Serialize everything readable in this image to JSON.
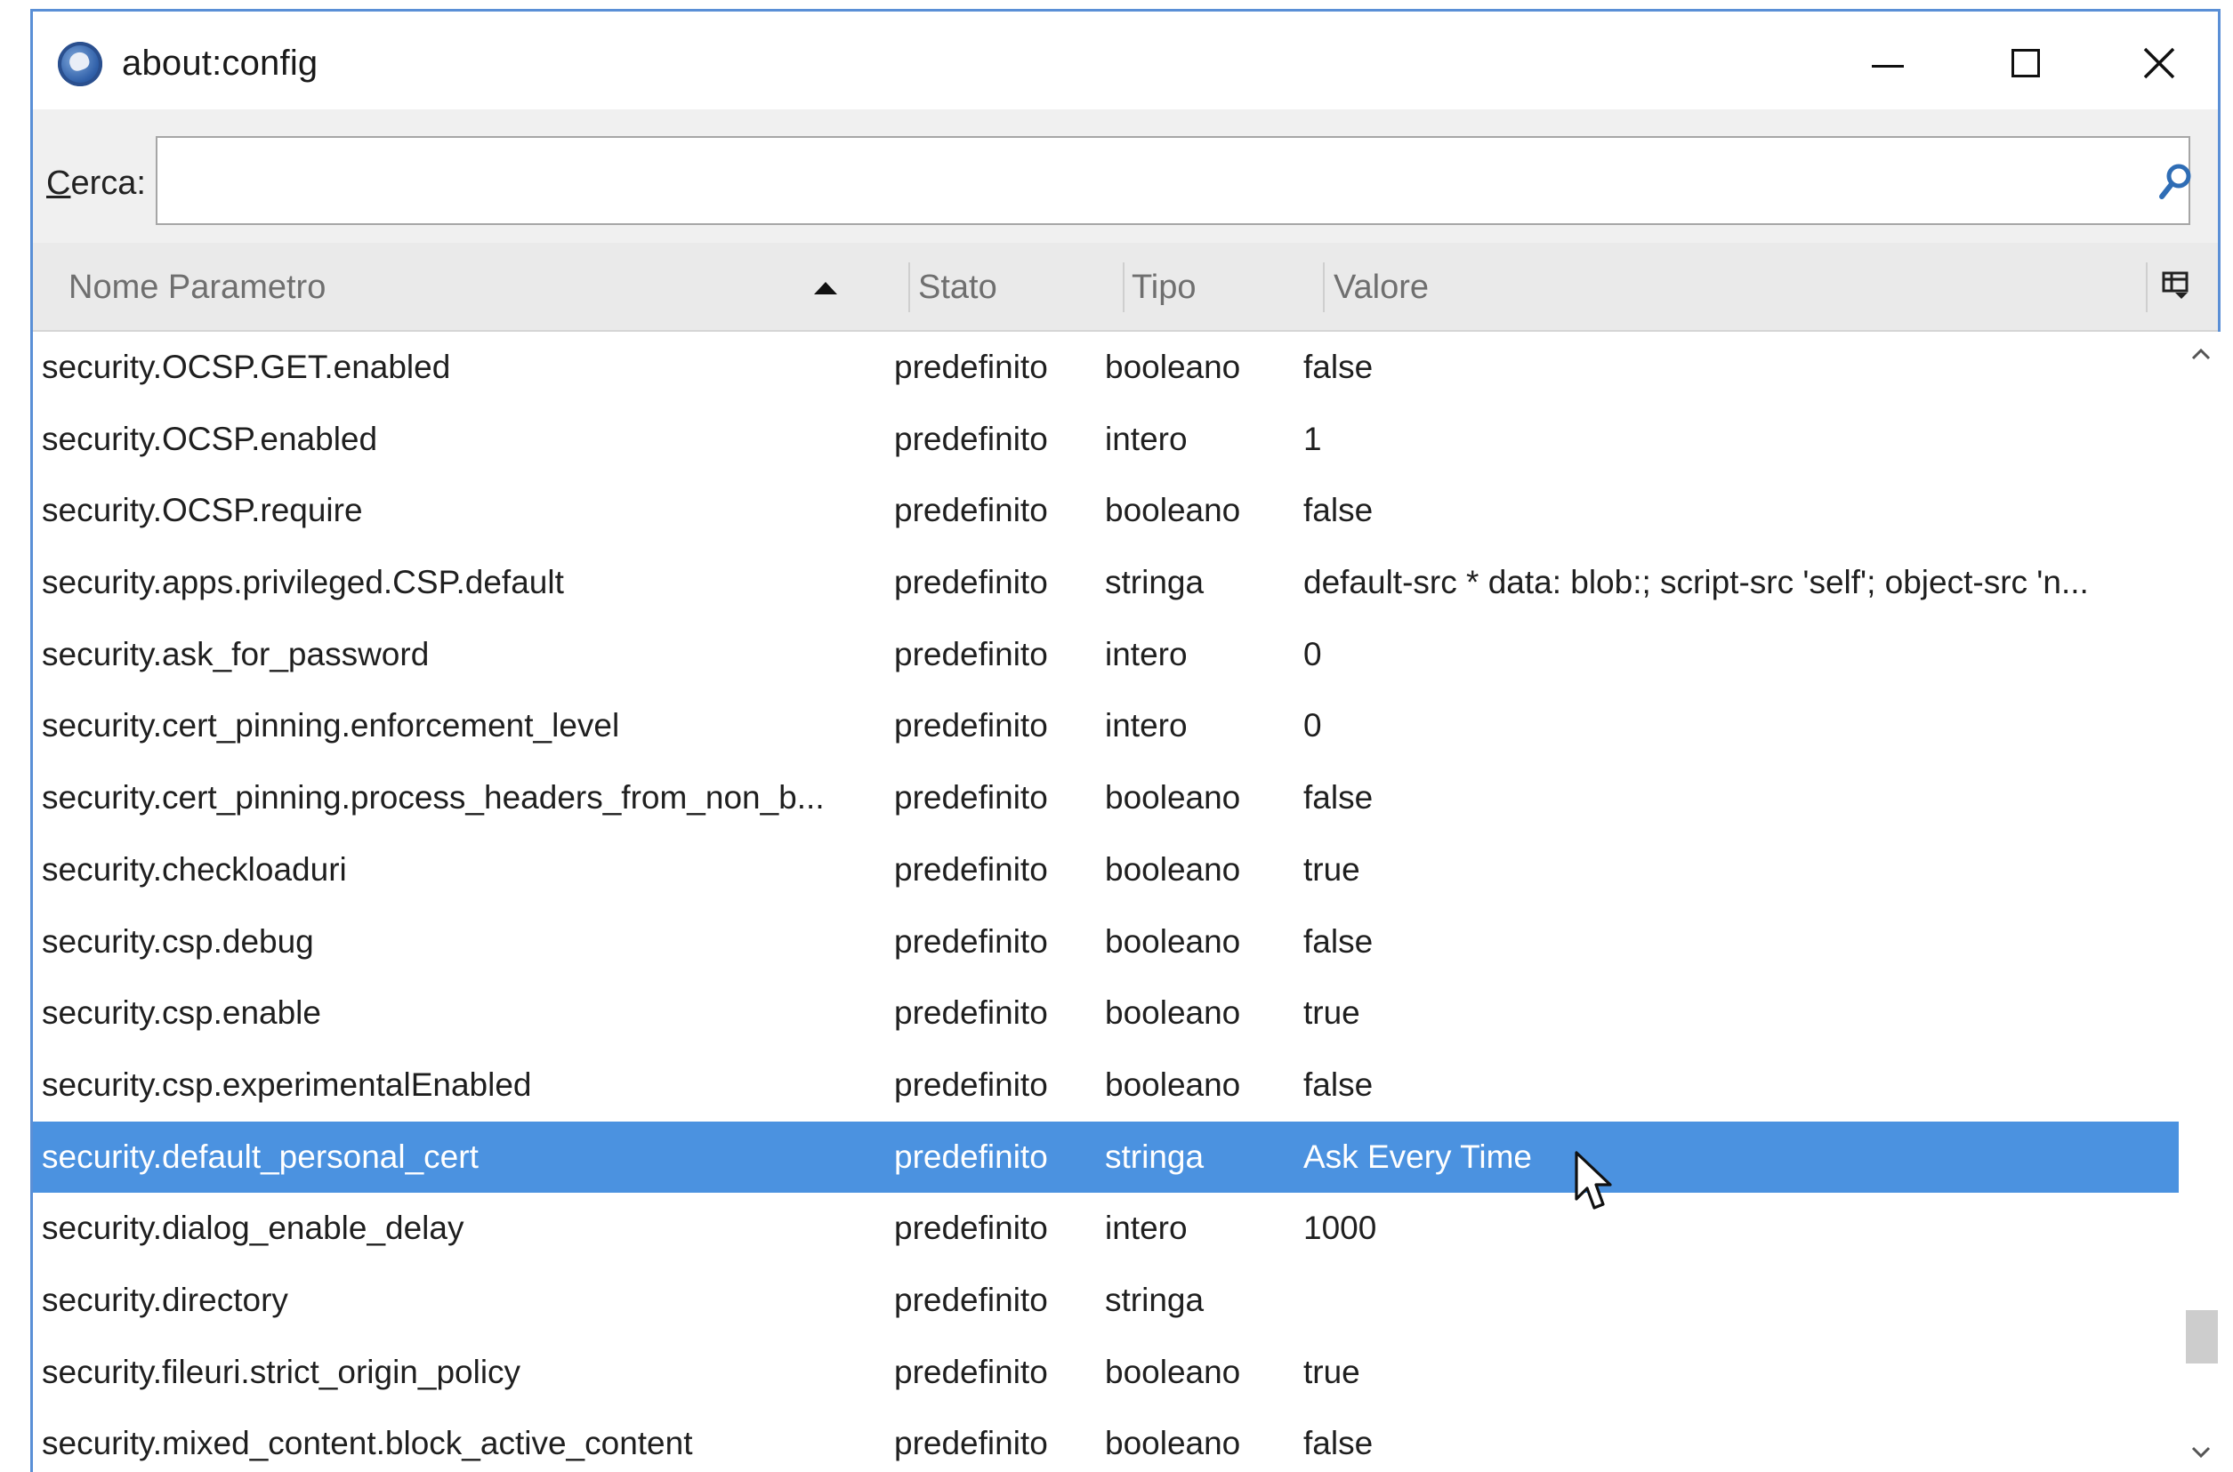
{
  "window": {
    "title": "about:config",
    "app_icon": "thunderbird-icon",
    "controls": [
      "minimize-icon",
      "maximize-icon",
      "close-icon"
    ]
  },
  "search": {
    "label_accesskey": "C",
    "label_rest": "erca:",
    "value": "",
    "placeholder": ""
  },
  "columns": {
    "name": "Nome Parametro",
    "stato": "Stato",
    "tipo": "Tipo",
    "valore": "Valore",
    "sort_direction": "ascending"
  },
  "rows": [
    {
      "name": "security.OCSP.GET.enabled",
      "stato": "predefinito",
      "tipo": "booleano",
      "valore": "false"
    },
    {
      "name": "security.OCSP.enabled",
      "stato": "predefinito",
      "tipo": "intero",
      "valore": "1"
    },
    {
      "name": "security.OCSP.require",
      "stato": "predefinito",
      "tipo": "booleano",
      "valore": "false"
    },
    {
      "name": "security.apps.privileged.CSP.default",
      "stato": "predefinito",
      "tipo": "stringa",
      "valore": "default-src * data: blob:; script-src 'self'; object-src 'n..."
    },
    {
      "name": "security.ask_for_password",
      "stato": "predefinito",
      "tipo": "intero",
      "valore": "0"
    },
    {
      "name": "security.cert_pinning.enforcement_level",
      "stato": "predefinito",
      "tipo": "intero",
      "valore": "0"
    },
    {
      "name": "security.cert_pinning.process_headers_from_non_b...",
      "stato": "predefinito",
      "tipo": "booleano",
      "valore": "false"
    },
    {
      "name": "security.checkloaduri",
      "stato": "predefinito",
      "tipo": "booleano",
      "valore": "true"
    },
    {
      "name": "security.csp.debug",
      "stato": "predefinito",
      "tipo": "booleano",
      "valore": "false"
    },
    {
      "name": "security.csp.enable",
      "stato": "predefinito",
      "tipo": "booleano",
      "valore": "true"
    },
    {
      "name": "security.csp.experimentalEnabled",
      "stato": "predefinito",
      "tipo": "booleano",
      "valore": "false"
    },
    {
      "name": "security.default_personal_cert",
      "stato": "predefinito",
      "tipo": "stringa",
      "valore": "Ask Every Time"
    },
    {
      "name": "security.dialog_enable_delay",
      "stato": "predefinito",
      "tipo": "intero",
      "valore": "1000"
    },
    {
      "name": "security.directory",
      "stato": "predefinito",
      "tipo": "stringa",
      "valore": ""
    },
    {
      "name": "security.fileuri.strict_origin_policy",
      "stato": "predefinito",
      "tipo": "booleano",
      "valore": "true"
    },
    {
      "name": "security.mixed_content.block_active_content",
      "stato": "predefinito",
      "tipo": "booleano",
      "valore": "false"
    }
  ],
  "selected_row_index": 11,
  "colors": {
    "selection": "#4b92e0",
    "window_border": "#5a8fd6",
    "header_bg": "#eaeaea",
    "search_bg": "#f0f0f0",
    "search_icon": "#2f6db5"
  }
}
